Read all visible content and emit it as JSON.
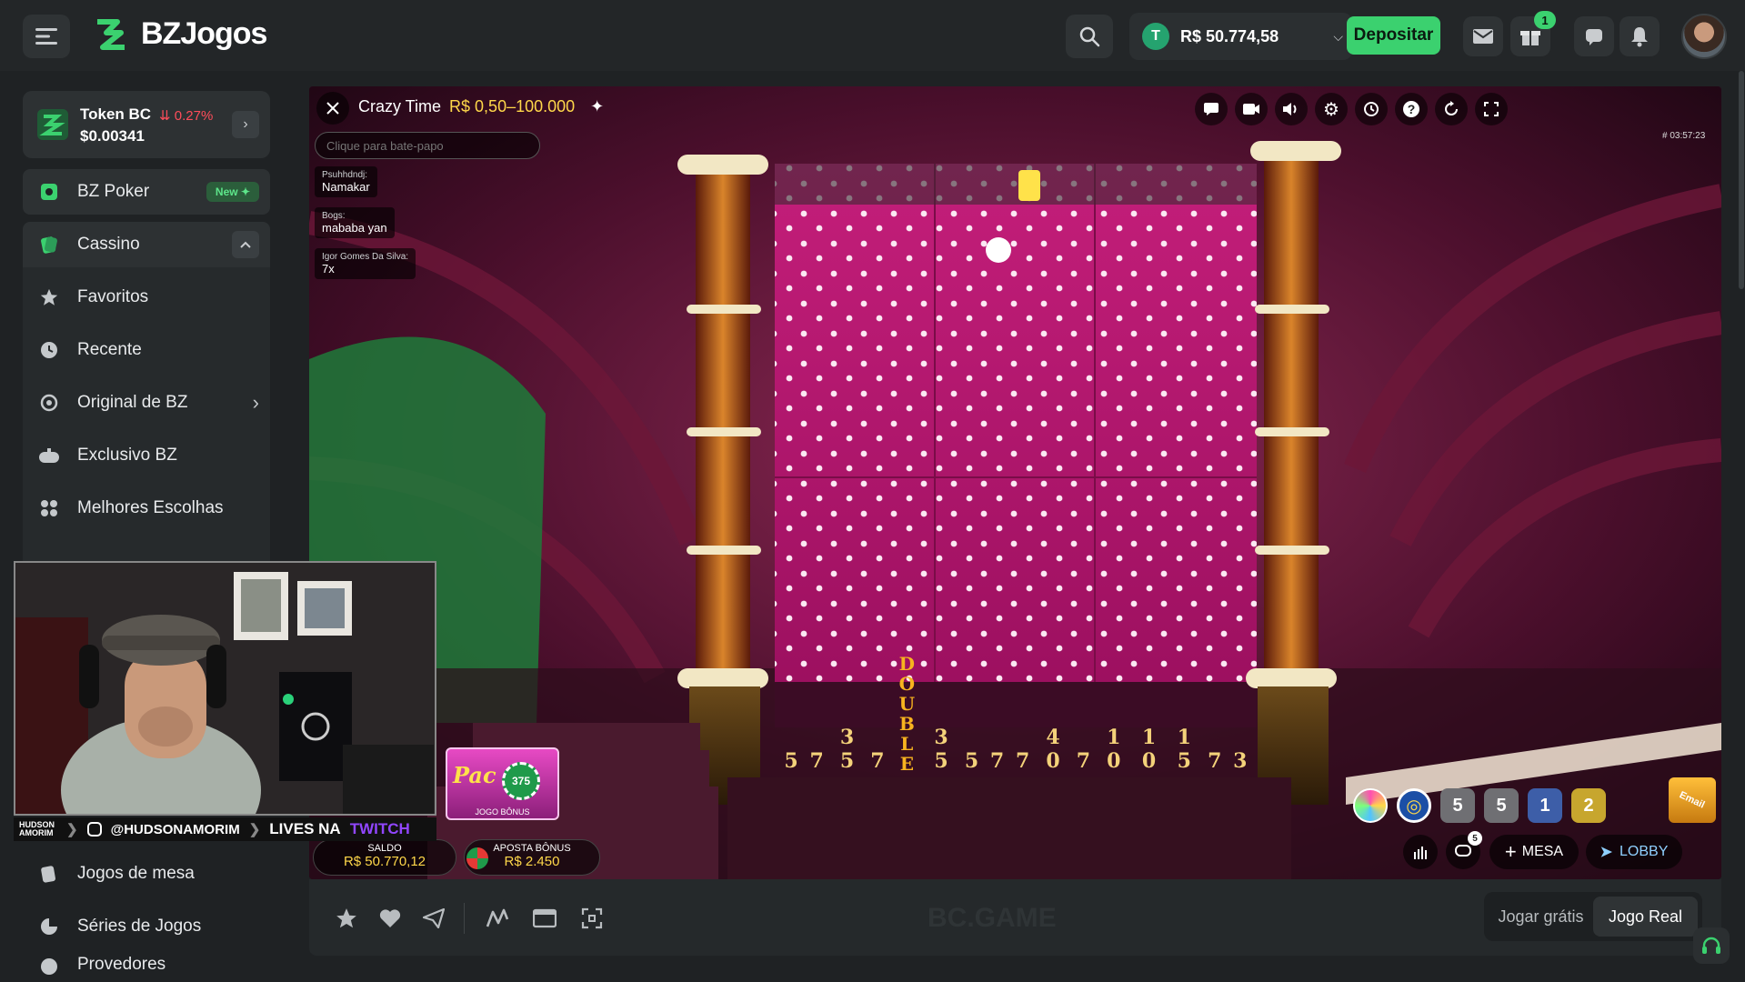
{
  "brand": {
    "name": "BZJogos"
  },
  "header": {
    "balance": "R$ 50.774,58",
    "currency_symbol": "T",
    "deposit_label": "Depositar",
    "gift_count": "1"
  },
  "sidebar": {
    "token": {
      "name": "Token BC",
      "change": "0.27%",
      "price": "$0.00341"
    },
    "items": [
      {
        "label": "BZ Poker",
        "badge": "New"
      },
      {
        "label": "Cassino"
      },
      {
        "label": "Favoritos"
      },
      {
        "label": "Recente"
      },
      {
        "label": "Original de BZ"
      },
      {
        "label": "Exclusivo BZ"
      },
      {
        "label": "Melhores Escolhas"
      },
      {
        "label": "Jogos de mesa"
      },
      {
        "label": "Séries de Jogos"
      },
      {
        "label": "Provedores"
      }
    ]
  },
  "stream": {
    "handle": "@HUDSONAMORIM",
    "lives_text": "LIVES NA",
    "platform": "TWITCH",
    "tag": "HUDSON AMORIM"
  },
  "game": {
    "title": "Crazy Time",
    "limits": "R$ 0,50–100.000",
    "chat_placeholder": "Clique para bate-papo",
    "round_id": "# 03:57:23",
    "chat": [
      {
        "user": "Psuhhdndj:",
        "msg": "Namakar"
      },
      {
        "user": "Bogs:",
        "msg": "mababa yan"
      },
      {
        "user": "Igor Gomes Da Silva:",
        "msg": "7x"
      }
    ],
    "slots": [
      "5",
      "7",
      "35",
      "7",
      "DOUBLE",
      "35",
      "5",
      "7",
      "7",
      "40",
      "7",
      "10",
      "10",
      "15",
      "7",
      "3"
    ],
    "history": [
      "5",
      "5",
      "1",
      "2"
    ],
    "balance_label": "SALDO",
    "balance_value": "R$ 50.770,12",
    "bonus_label": "APOSTA BÔNUS",
    "bonus_value": "R$ 2.450",
    "pachinko_label": "JOGO BÔNUS",
    "pachinko_value": "375",
    "mesa_label": "MESA",
    "lobby_label": "LOBBY",
    "chat_count": "5",
    "watermark": "BC.GAME",
    "email_tag": "Email"
  },
  "footer": {
    "free_label": "Jogar grátis",
    "real_label": "Jogo Real"
  },
  "colors": {
    "accent": "#3bd16f",
    "negative": "#ff4d5a",
    "sidebar_bg": "#1f2224",
    "game_bg": "#8e1255"
  }
}
